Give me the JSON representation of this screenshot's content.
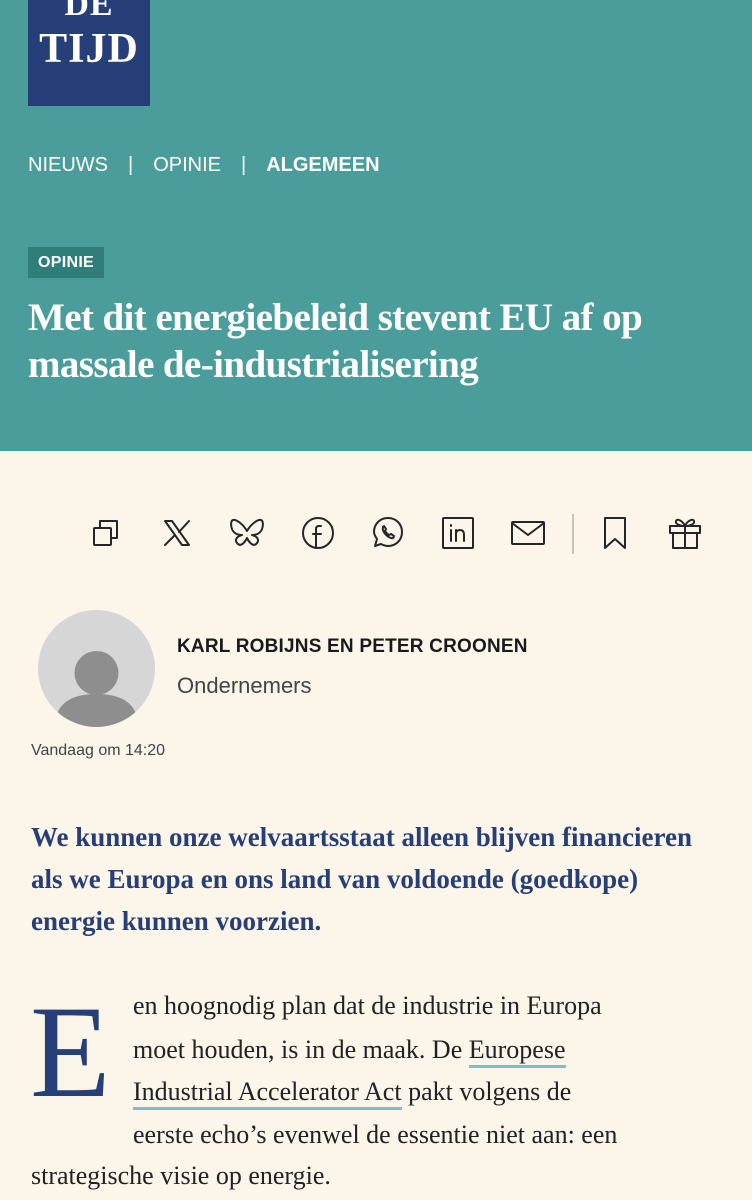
{
  "brand": {
    "logo_line1": "DE",
    "logo_line2": "TIJD"
  },
  "breadcrumb": [
    "NIEUWS",
    "OPINIE",
    "ALGEMEEN"
  ],
  "article": {
    "tag": "OPINIE",
    "headline": "Met dit energiebeleid stevent EU af op massale de-industrialisering",
    "author": "KARL ROBIJNS EN PETER CROONEN",
    "author_role": "Ondernemers",
    "date": "Vandaag om 14:20",
    "lead": "We kunnen onze welvaartsstaat alleen blijven financieren als we Europa en ons land van voldoende (goedkope) energie kunnen voorzien.",
    "dropcap": "E",
    "body_line1": "en hoognodig plan dat de industrie in Europa",
    "body_line2_pre": "moet houden, is in de maak. De ",
    "body_link_part1": "Europese",
    "body_link_part2": "Industrial Accelerator Act",
    "body_line3_post": " pakt volgens de",
    "body_line4": "eerste echo’s evenwel de essentie niet aan: een",
    "body_line5": "strategische visie op energie."
  },
  "share_icons": [
    "copy-icon",
    "x-icon",
    "bluesky-icon",
    "facebook-icon",
    "whatsapp-icon",
    "linkedin-icon",
    "mail-icon",
    "bookmark-icon",
    "gift-icon"
  ],
  "colors": {
    "header_bg": "#4a9d9a",
    "logo_bg": "#263f78",
    "page_bg": "#fcf5ea",
    "lead_text": "#263f78",
    "link_underline": "#7fbfbd"
  }
}
